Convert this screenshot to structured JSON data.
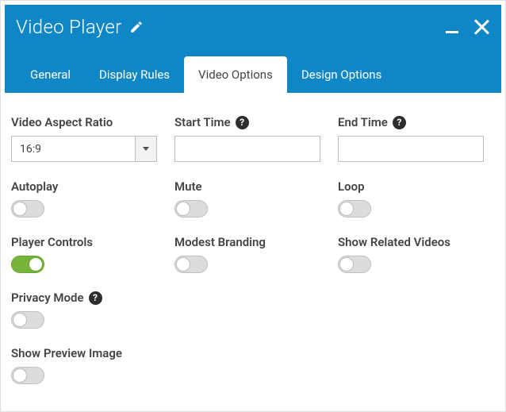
{
  "header": {
    "title": "Video Player"
  },
  "tabs": {
    "general": "General",
    "display_rules": "Display Rules",
    "video_options": "Video Options",
    "design_options": "Design Options",
    "active": "video_options"
  },
  "fields": {
    "aspect_ratio": {
      "label": "Video Aspect Ratio",
      "value": "16:9"
    },
    "start_time": {
      "label": "Start Time",
      "value": ""
    },
    "end_time": {
      "label": "End Time",
      "value": ""
    },
    "autoplay": {
      "label": "Autoplay",
      "on": false
    },
    "mute": {
      "label": "Mute",
      "on": false
    },
    "loop": {
      "label": "Loop",
      "on": false
    },
    "player_controls": {
      "label": "Player Controls",
      "on": true
    },
    "modest_branding": {
      "label": "Modest Branding",
      "on": false
    },
    "show_related": {
      "label": "Show Related Videos",
      "on": false
    },
    "privacy_mode": {
      "label": "Privacy Mode",
      "on": false
    },
    "show_preview": {
      "label": "Show Preview Image",
      "on": false
    }
  },
  "help_glyph": "?"
}
